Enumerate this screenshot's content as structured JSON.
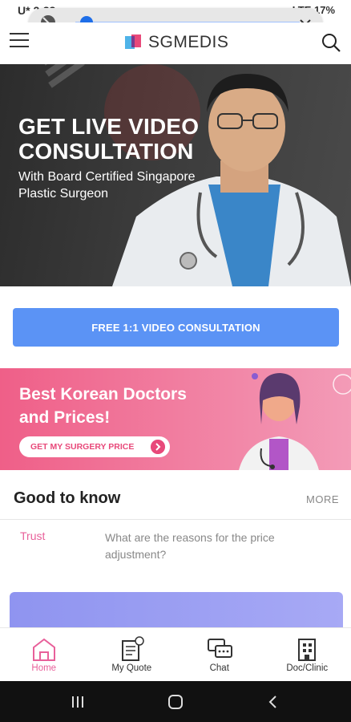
{
  "status_bar": {
    "time": "U* 2:33",
    "indicators": "LTE 17%"
  },
  "media_overlay": {
    "progress": 0.05
  },
  "header": {
    "brand": "SGMEDIS",
    "menu_icon": "hamburger-menu-icon",
    "search_icon": "search-icon"
  },
  "hero": {
    "title": "GET LIVE VIDEO CONSULTATION",
    "subtitle": "With Board Certified Singapore Plastic Surgeon"
  },
  "consult_button": {
    "label": "FREE 1:1 VIDEO CONSULTATION"
  },
  "promo": {
    "title": "Best Korean Doctors and Prices!",
    "cta": "GET MY SURGERY PRICE"
  },
  "good_to_know": {
    "title": "Good to know",
    "more": "MORE",
    "items": [
      {
        "tag": "Trust",
        "question": "What are the reasons for the price adjustment?"
      }
    ]
  },
  "bottom_nav": {
    "items": [
      {
        "label": "Home",
        "icon": "home-icon",
        "active": true
      },
      {
        "label": "My Quote",
        "icon": "quote-icon"
      },
      {
        "label": "Chat",
        "icon": "chat-icon"
      },
      {
        "label": "Doc/Clinic",
        "icon": "clinic-icon"
      }
    ]
  },
  "colors": {
    "primary_blue": "#5b93f5",
    "pink": "#e8609a",
    "promo_start": "#ef5f88",
    "promo_end": "#f39bb7"
  }
}
